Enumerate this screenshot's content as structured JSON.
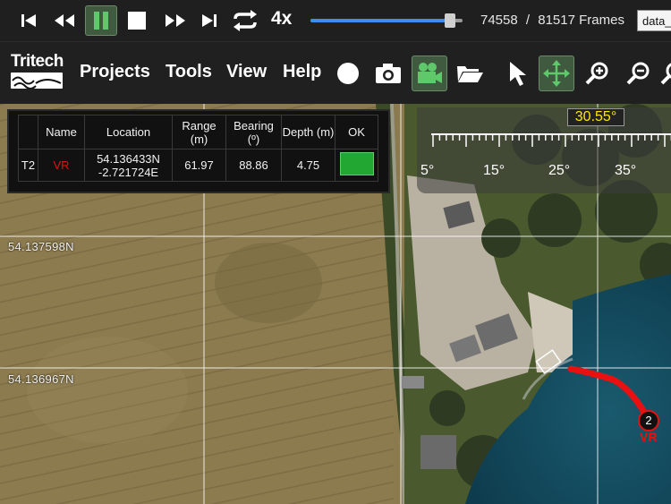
{
  "playback": {
    "speed": "4x",
    "progress": 0.915,
    "current_frame": "74558",
    "separator": "/",
    "total_frames": "81517 Frames",
    "data_file": "data_"
  },
  "menu": {
    "logo_text": "Tritech",
    "items": [
      "Projects",
      "Tools",
      "View",
      "Help"
    ]
  },
  "targets_table": {
    "headers": [
      "",
      "Name",
      "Location",
      "Range (m)",
      "Bearing (º)",
      "Depth (m)",
      "OK"
    ],
    "row": {
      "id": "T2",
      "name": "VR",
      "location_lat": "54.136433N",
      "location_lon": "-2.721724E",
      "range": "61.97",
      "bearing": "88.86",
      "depth": "4.75"
    }
  },
  "bearing_scale": {
    "readout": "30.55°",
    "labels": [
      "5°",
      "15°",
      "25°",
      "35°"
    ]
  },
  "grid_labels": [
    "54.137598N",
    "54.136967N"
  ],
  "target_marker": {
    "number": "2",
    "label": "VR"
  },
  "colors": {
    "accent_green": "#22a832",
    "slider_blue": "#3a8fe8",
    "target_red": "#e81010",
    "readout_yellow": "#ffe600",
    "toolbar_bg": "#1f1f1f"
  }
}
